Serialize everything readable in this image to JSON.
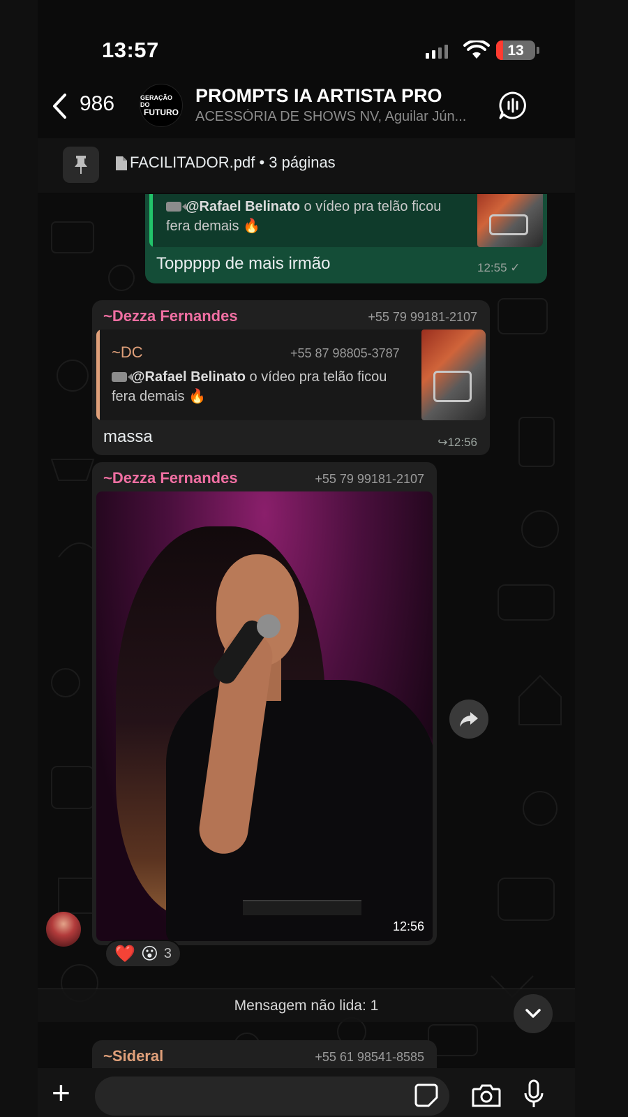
{
  "status_bar": {
    "time": "13:57",
    "battery": "13",
    "battery_level": 0.13
  },
  "header": {
    "back_count": "986",
    "group_logo_line1": "GERAÇÃO DO",
    "group_logo_line2": "FUTURO",
    "group_name": "PROMPTS IA ARTISTA PRO",
    "group_members": "ACESSÓRIA DE SHOWS NV, Aguilar Jún..."
  },
  "pinned": {
    "file_name": "FACILITADOR.pdf",
    "pages": "3 páginas"
  },
  "messages": {
    "m1": {
      "quote_mention": "@Rafael Belinato",
      "quote_text": " o vídeo pra telão ficou fera demais 🔥",
      "text": "Toppppp de mais irmão",
      "time": "12:55"
    },
    "m2": {
      "sender": "~Dezza Fernandes",
      "sender_phone": "+55 79 99181-2107",
      "sender_color": "#f06fa2",
      "quote_sender": "~DC",
      "quote_phone": "+55 87 98805-3787",
      "quote_color": "#e0a07a",
      "quote_mention": "@Rafael Belinato",
      "quote_text": " o vídeo pra telão ficou fera demais 🔥",
      "text": "massa",
      "time": "12:56"
    },
    "m3": {
      "sender": "~Dezza Fernandes",
      "sender_phone": "+55 79 99181-2107",
      "time": "12:56",
      "reactions": [
        "❤️",
        "😮"
      ],
      "reaction_count": "3"
    },
    "m4": {
      "sender": "~Sideral",
      "sender_phone": "+55 61 98541-8585",
      "sender_color": "#e0a07a"
    }
  },
  "unread_banner": "Mensagem não lida: 1",
  "icons": {
    "back": "chevron-left-icon",
    "voice_chat": "voice-chat-icon",
    "pin": "pin-icon",
    "document": "document-icon",
    "forward": "forward-icon",
    "scroll_down": "chevron-down-icon",
    "attach": "plus-icon",
    "sticker": "sticker-icon",
    "camera": "camera-icon",
    "microphone": "microphone-icon"
  },
  "colors": {
    "outgoing_bubble": "#144d37",
    "incoming_bubble": "#202020",
    "accent_pink": "#f06fa2",
    "accent_tan": "#e0a07a"
  }
}
